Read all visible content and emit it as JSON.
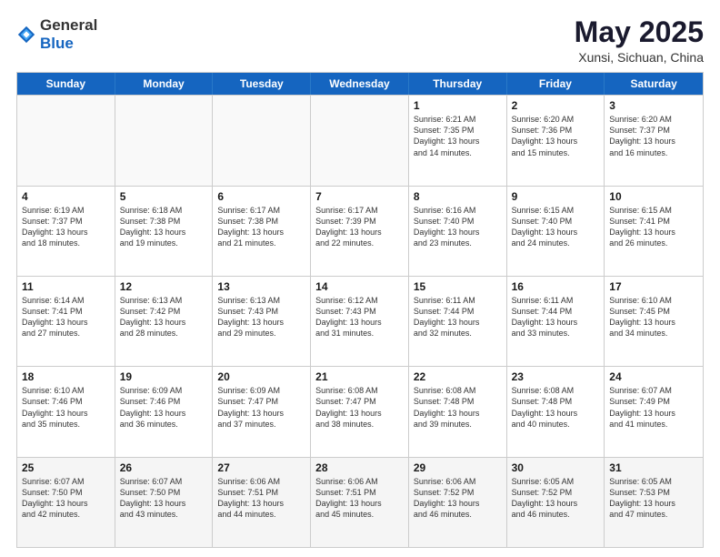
{
  "logo": {
    "general": "General",
    "blue": "Blue"
  },
  "title": "May 2025",
  "location": "Xunsi, Sichuan, China",
  "dayHeaders": [
    "Sunday",
    "Monday",
    "Tuesday",
    "Wednesday",
    "Thursday",
    "Friday",
    "Saturday"
  ],
  "weeks": [
    [
      {
        "day": "",
        "empty": true
      },
      {
        "day": "",
        "empty": true
      },
      {
        "day": "",
        "empty": true
      },
      {
        "day": "",
        "empty": true
      },
      {
        "day": "1",
        "sunrise": "6:21 AM",
        "sunset": "7:35 PM",
        "daylight": "13 hours and 14 minutes."
      },
      {
        "day": "2",
        "sunrise": "6:20 AM",
        "sunset": "7:36 PM",
        "daylight": "13 hours and 15 minutes."
      },
      {
        "day": "3",
        "sunrise": "6:20 AM",
        "sunset": "7:37 PM",
        "daylight": "13 hours and 16 minutes."
      }
    ],
    [
      {
        "day": "4",
        "sunrise": "6:19 AM",
        "sunset": "7:37 PM",
        "daylight": "13 hours and 18 minutes."
      },
      {
        "day": "5",
        "sunrise": "6:18 AM",
        "sunset": "7:38 PM",
        "daylight": "13 hours and 19 minutes."
      },
      {
        "day": "6",
        "sunrise": "6:17 AM",
        "sunset": "7:38 PM",
        "daylight": "13 hours and 21 minutes."
      },
      {
        "day": "7",
        "sunrise": "6:17 AM",
        "sunset": "7:39 PM",
        "daylight": "13 hours and 22 minutes."
      },
      {
        "day": "8",
        "sunrise": "6:16 AM",
        "sunset": "7:40 PM",
        "daylight": "13 hours and 23 minutes."
      },
      {
        "day": "9",
        "sunrise": "6:15 AM",
        "sunset": "7:40 PM",
        "daylight": "13 hours and 24 minutes."
      },
      {
        "day": "10",
        "sunrise": "6:15 AM",
        "sunset": "7:41 PM",
        "daylight": "13 hours and 26 minutes."
      }
    ],
    [
      {
        "day": "11",
        "sunrise": "6:14 AM",
        "sunset": "7:41 PM",
        "daylight": "13 hours and 27 minutes."
      },
      {
        "day": "12",
        "sunrise": "6:13 AM",
        "sunset": "7:42 PM",
        "daylight": "13 hours and 28 minutes."
      },
      {
        "day": "13",
        "sunrise": "6:13 AM",
        "sunset": "7:43 PM",
        "daylight": "13 hours and 29 minutes."
      },
      {
        "day": "14",
        "sunrise": "6:12 AM",
        "sunset": "7:43 PM",
        "daylight": "13 hours and 31 minutes."
      },
      {
        "day": "15",
        "sunrise": "6:11 AM",
        "sunset": "7:44 PM",
        "daylight": "13 hours and 32 minutes."
      },
      {
        "day": "16",
        "sunrise": "6:11 AM",
        "sunset": "7:44 PM",
        "daylight": "13 hours and 33 minutes."
      },
      {
        "day": "17",
        "sunrise": "6:10 AM",
        "sunset": "7:45 PM",
        "daylight": "13 hours and 34 minutes."
      }
    ],
    [
      {
        "day": "18",
        "sunrise": "6:10 AM",
        "sunset": "7:46 PM",
        "daylight": "13 hours and 35 minutes."
      },
      {
        "day": "19",
        "sunrise": "6:09 AM",
        "sunset": "7:46 PM",
        "daylight": "13 hours and 36 minutes."
      },
      {
        "day": "20",
        "sunrise": "6:09 AM",
        "sunset": "7:47 PM",
        "daylight": "13 hours and 37 minutes."
      },
      {
        "day": "21",
        "sunrise": "6:08 AM",
        "sunset": "7:47 PM",
        "daylight": "13 hours and 38 minutes."
      },
      {
        "day": "22",
        "sunrise": "6:08 AM",
        "sunset": "7:48 PM",
        "daylight": "13 hours and 39 minutes."
      },
      {
        "day": "23",
        "sunrise": "6:08 AM",
        "sunset": "7:48 PM",
        "daylight": "13 hours and 40 minutes."
      },
      {
        "day": "24",
        "sunrise": "6:07 AM",
        "sunset": "7:49 PM",
        "daylight": "13 hours and 41 minutes."
      }
    ],
    [
      {
        "day": "25",
        "sunrise": "6:07 AM",
        "sunset": "7:50 PM",
        "daylight": "13 hours and 42 minutes."
      },
      {
        "day": "26",
        "sunrise": "6:07 AM",
        "sunset": "7:50 PM",
        "daylight": "13 hours and 43 minutes."
      },
      {
        "day": "27",
        "sunrise": "6:06 AM",
        "sunset": "7:51 PM",
        "daylight": "13 hours and 44 minutes."
      },
      {
        "day": "28",
        "sunrise": "6:06 AM",
        "sunset": "7:51 PM",
        "daylight": "13 hours and 45 minutes."
      },
      {
        "day": "29",
        "sunrise": "6:06 AM",
        "sunset": "7:52 PM",
        "daylight": "13 hours and 46 minutes."
      },
      {
        "day": "30",
        "sunrise": "6:05 AM",
        "sunset": "7:52 PM",
        "daylight": "13 hours and 46 minutes."
      },
      {
        "day": "31",
        "sunrise": "6:05 AM",
        "sunset": "7:53 PM",
        "daylight": "13 hours and 47 minutes."
      }
    ]
  ]
}
